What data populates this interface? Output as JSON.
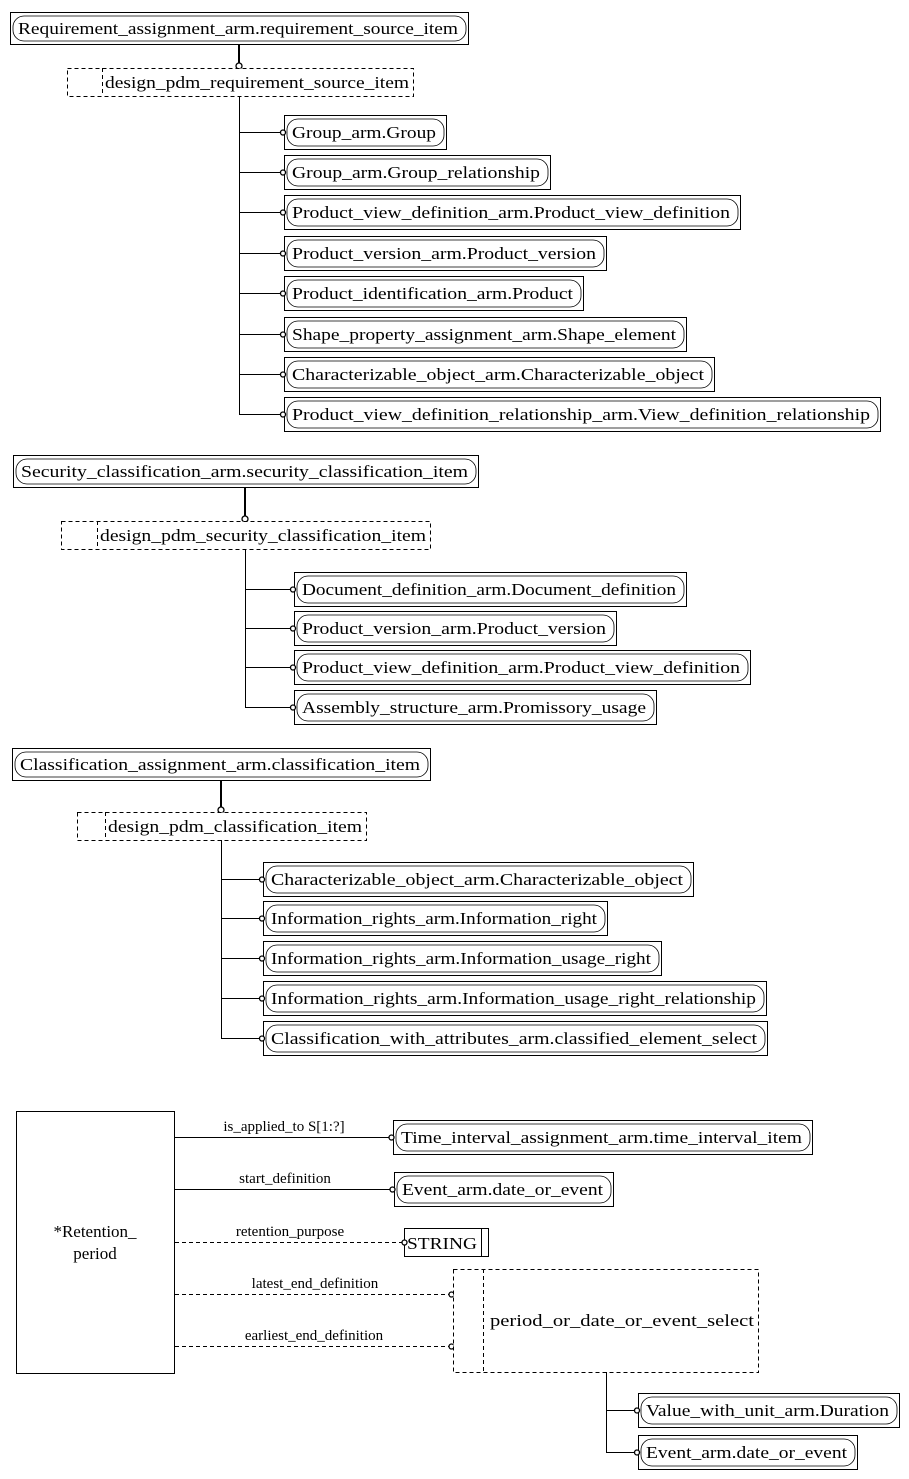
{
  "groups": [
    {
      "select_type": "Requirement_assignment_arm.requirement_source_item",
      "extension": "design_pdm_requirement_source_item",
      "items": [
        "Group_arm.Group",
        "Group_arm.Group_relationship",
        "Product_view_definition_arm.Product_view_definition",
        "Product_version_arm.Product_version",
        "Product_identification_arm.Product",
        "Shape_property_assignment_arm.Shape_element",
        "Characterizable_object_arm.Characterizable_object",
        "Product_view_definition_relationship_arm.View_definition_relationship"
      ]
    },
    {
      "select_type": "Security_classification_arm.security_classification_item",
      "extension": "design_pdm_security_classification_item",
      "items": [
        "Document_definition_arm.Document_definition",
        "Product_version_arm.Product_version",
        "Product_view_definition_arm.Product_view_definition",
        "Assembly_structure_arm.Promissory_usage"
      ]
    },
    {
      "select_type": "Classification_assignment_arm.classification_item",
      "extension": "design_pdm_classification_item",
      "items": [
        "Characterizable_object_arm.Characterizable_object",
        "Information_rights_arm.Information_right",
        "Information_rights_arm.Information_usage_right",
        "Information_rights_arm.Information_usage_right_relationship",
        "Classification_with_attributes_arm.classified_element_select"
      ]
    }
  ],
  "entity": {
    "name_line1": "*Retention_",
    "name_line2": "period",
    "attributes": [
      {
        "name": "is_applied_to S[1:?]",
        "target": "Time_interval_assignment_arm.time_interval_item",
        "optional": false
      },
      {
        "name": "start_definition",
        "target": "Event_arm.date_or_event",
        "optional": false
      },
      {
        "name": "retention_purpose",
        "target": "STRING",
        "optional": true
      },
      {
        "name": "latest_end_definition",
        "target": "period_or_date_or_event_select",
        "optional": true
      },
      {
        "name": "earliest_end_definition",
        "target": "period_or_date_or_event_select",
        "optional": true
      }
    ],
    "select_name": "period_or_date_or_event_select",
    "select_items": [
      "Value_with_unit_arm.Duration",
      "Event_arm.date_or_event"
    ]
  },
  "colors": {
    "line": "#000000",
    "background": "#ffffff"
  }
}
